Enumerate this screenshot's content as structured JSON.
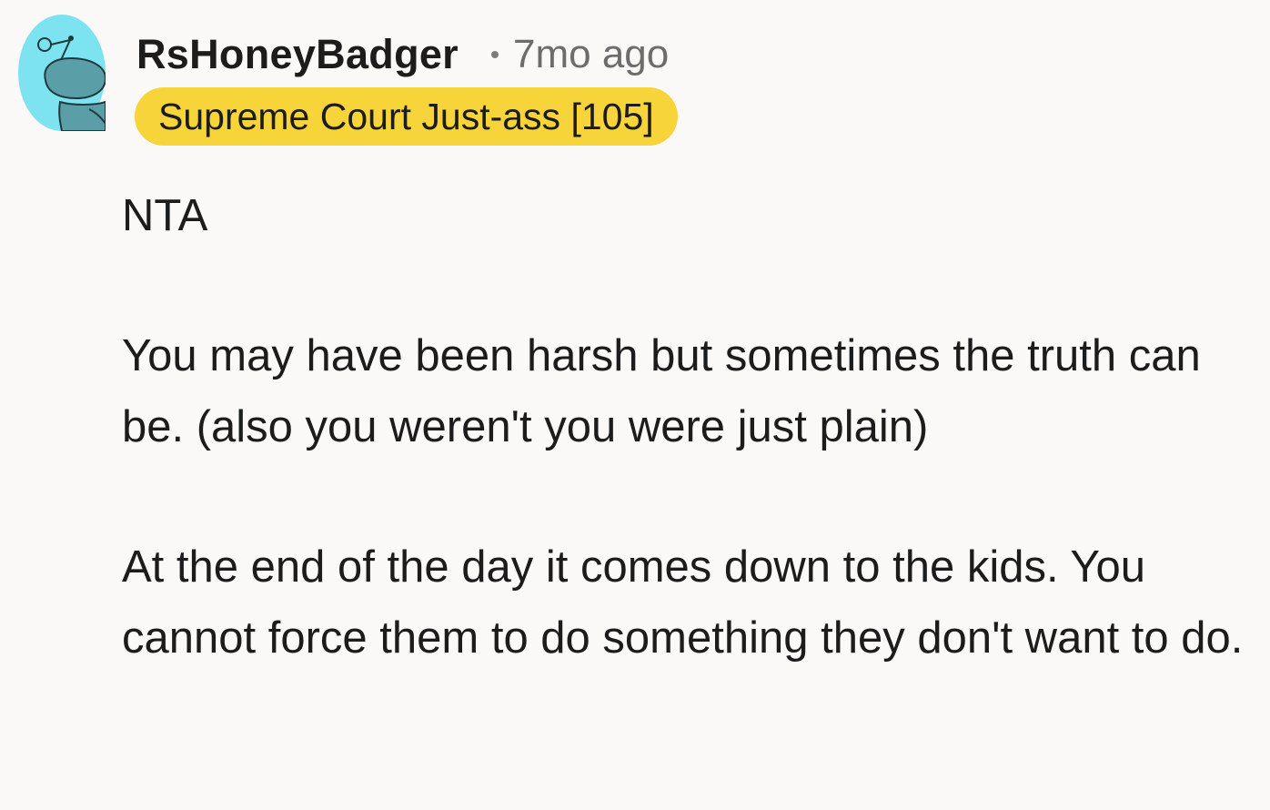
{
  "comment": {
    "author": "RsHoneyBadger",
    "separator": "•",
    "age": "7mo ago",
    "flair": "Supreme Court Just-ass [105]",
    "flair_color": "#f6d43a",
    "avatar_icon": "snoo-avatar-icon",
    "avatar_color": "#7ee3f0",
    "paragraphs": [
      "NTA",
      "You may have been harsh but sometimes the truth can be. (also you weren't you were just plain)",
      "At the end of the day it comes down to the kids. You cannot force them to do something they don't want to do."
    ]
  }
}
